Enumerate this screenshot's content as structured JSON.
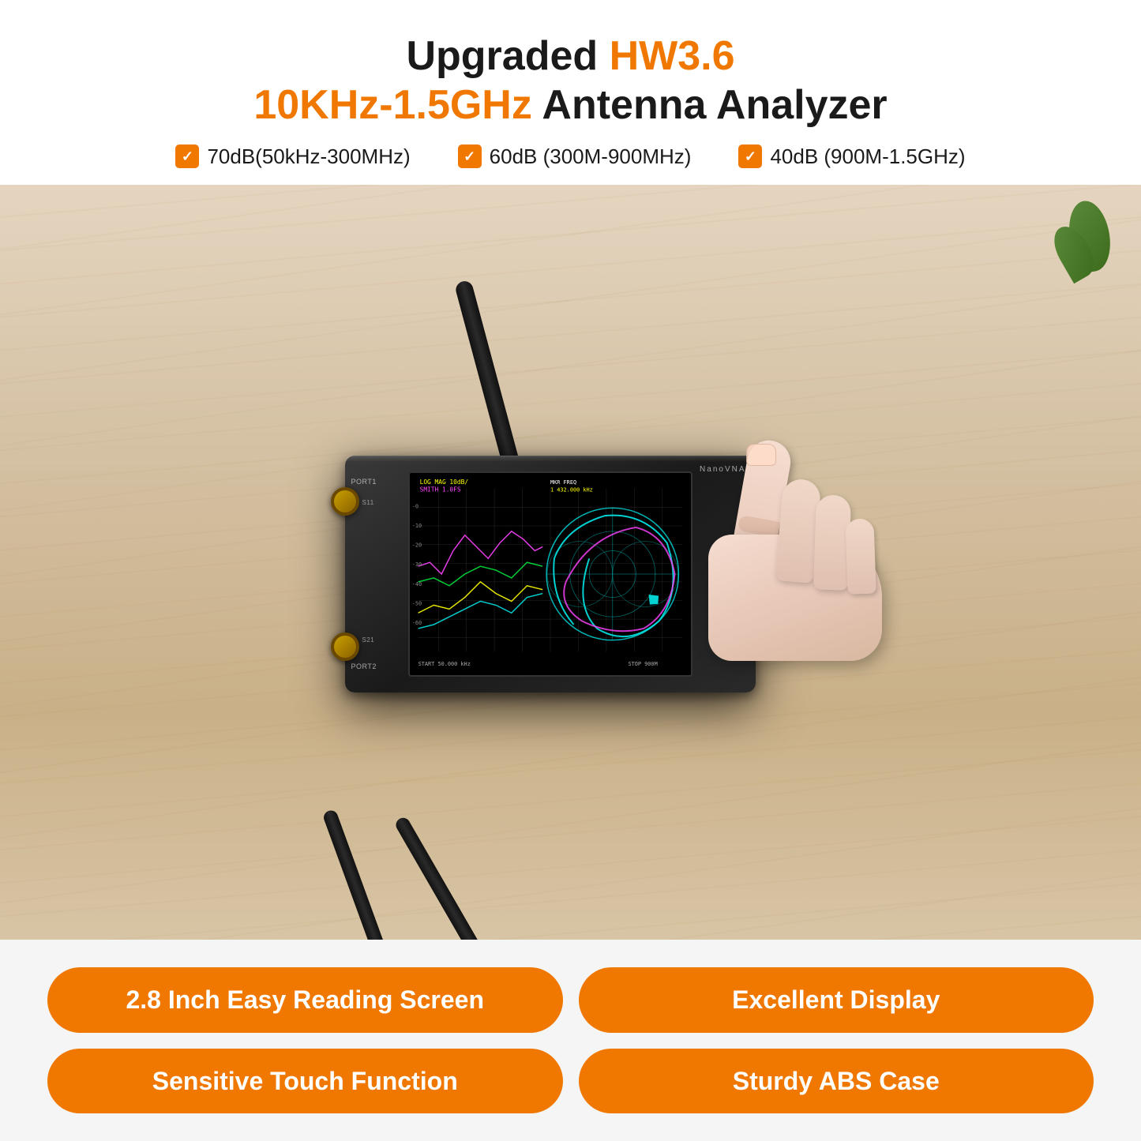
{
  "header": {
    "title_line1_prefix": "Upgraded ",
    "title_line1_highlight": "HW3.6",
    "title_line2_highlight": "10KHz-1.5GHz",
    "title_line2_suffix": " Antenna Analyzer",
    "specs": [
      {
        "label": "70dB(50kHz-300MHz)"
      },
      {
        "label": "60dB (300M-900MHz)"
      },
      {
        "label": "40dB (900M-1.5GHz)"
      }
    ]
  },
  "device": {
    "brand": "NanoVNA",
    "port1_label": "PORT1",
    "port2_label": "PORT2",
    "s11_label": "S11",
    "s21_label": "S21"
  },
  "features": [
    {
      "id": "screen",
      "label": "2.8 Inch Easy Reading Screen"
    },
    {
      "id": "display",
      "label": "Excellent Display"
    },
    {
      "id": "touch",
      "label": "Sensitive Touch Function"
    },
    {
      "id": "case",
      "label": "Sturdy ABS Case"
    }
  ],
  "colors": {
    "orange": "#f07800",
    "dark": "#1a1a1a",
    "white": "#ffffff"
  }
}
